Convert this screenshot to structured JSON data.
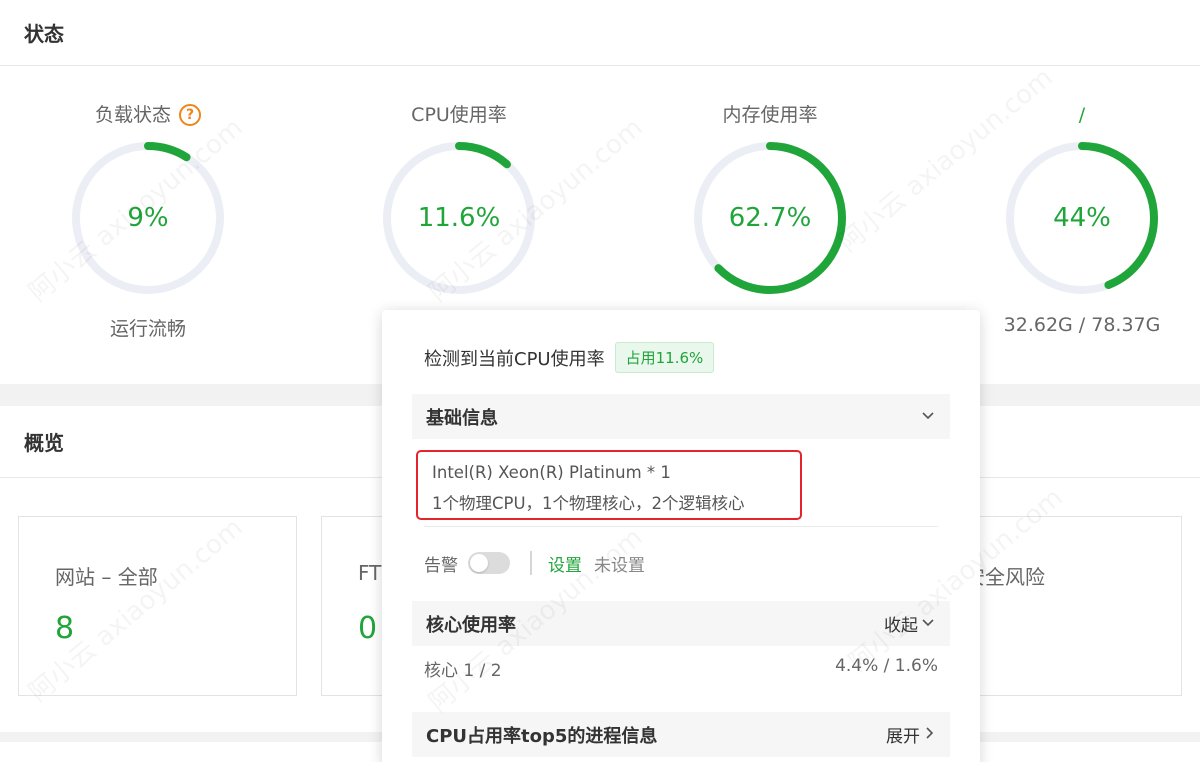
{
  "status": {
    "title": "状态",
    "gauges": [
      {
        "title": "负载状态",
        "has_help": true,
        "value_text": "9%",
        "percent": 9,
        "subtitle": "运行流畅"
      },
      {
        "title": "CPU使用率",
        "value_text": "11.6%",
        "percent": 11.6,
        "subtitle": ""
      },
      {
        "title": "内存使用率",
        "value_text": "62.7%",
        "percent": 62.7,
        "subtitle": ""
      },
      {
        "title": "/",
        "value_text": "44%",
        "percent": 44,
        "subtitle": "32.62G / 78.37G"
      }
    ],
    "help_icon_text": "?"
  },
  "overview": {
    "title": "概览",
    "cards": [
      {
        "label": "网站 – 全部",
        "value": "8"
      },
      {
        "label": "FT",
        "value": "0"
      },
      {
        "label": "安全风险",
        "value": ""
      }
    ]
  },
  "cpu_popover": {
    "title": "检测到当前CPU使用率",
    "badge": "占用11.6%",
    "basic_section": {
      "title": "基础信息"
    },
    "cpu_model": "Intel(R) Xeon(R) Platinum * 1",
    "cpu_cores": "1个物理CPU，1个物理核心，2个逻辑核心",
    "alarm": {
      "label": "告警",
      "enabled": false,
      "set_link": "设置",
      "status": "未设置"
    },
    "core_section": {
      "title": "核心使用率",
      "action": "收起"
    },
    "core_usage": {
      "label": "核心 1 / 2",
      "value": "4.4% / 1.6%"
    },
    "top5_section": {
      "title": "CPU占用率top5的进程信息",
      "action": "展开"
    }
  },
  "icons": [
    "help-icon",
    "chevron-down-icon",
    "chevron-right-icon"
  ],
  "colors": {
    "accent": "#20a53a",
    "ring_track": "#eceef6",
    "highlight": "#e5232b",
    "help": "#f0851a"
  },
  "watermark": "阿小云 axiaoyun.com"
}
